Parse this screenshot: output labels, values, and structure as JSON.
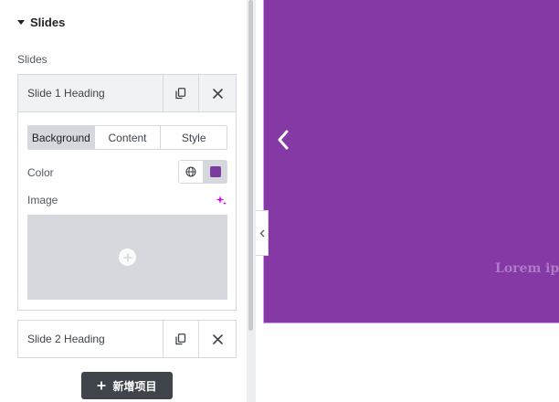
{
  "section": {
    "title": "Slides"
  },
  "repeater": {
    "label": "Slides",
    "items": [
      {
        "title": "Slide 1 Heading"
      },
      {
        "title": "Slide 2 Heading"
      }
    ],
    "add_label": "新增项目"
  },
  "slide_editor": {
    "tabs": [
      {
        "label": "Background",
        "active": true
      },
      {
        "label": "Content",
        "active": false
      },
      {
        "label": "Style",
        "active": false
      }
    ],
    "color_label": "Color",
    "color_value": "#7b3c9c",
    "image_label": "Image"
  },
  "preview": {
    "background": "#8439a4",
    "text": "Lorem ip"
  },
  "icons": {
    "section_toggle": "caret-down-icon",
    "duplicate": "duplicate-icon",
    "remove": "close-icon",
    "global": "globe-icon",
    "ai": "sparkle-icon",
    "add_media": "plus-circle-icon",
    "add_item": "plus-icon",
    "collapse": "chevron-left-icon",
    "prev_slide": "chevron-left-icon"
  }
}
